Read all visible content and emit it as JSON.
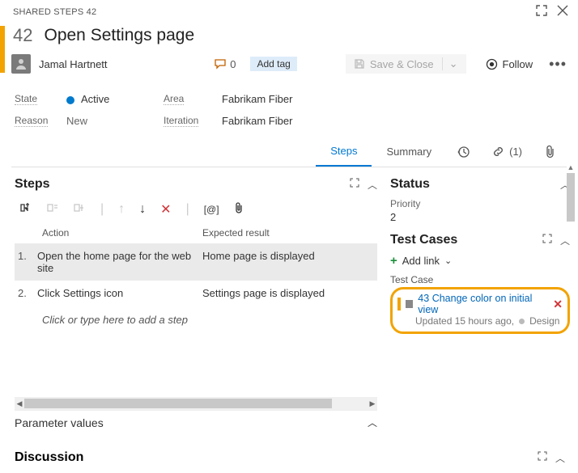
{
  "header": {
    "breadcrumb": "SHARED STEPS 42"
  },
  "workitem": {
    "id": "42",
    "title": "Open Settings page",
    "assignee": "Jamal Hartnett",
    "discussion_count": "0",
    "add_tag": "Add tag",
    "save": "Save & Close",
    "follow": "Follow"
  },
  "fields": {
    "state_label": "State",
    "state_value": "Active",
    "reason_label": "Reason",
    "reason_value": "New",
    "area_label": "Area",
    "area_value": "Fabrikam Fiber",
    "iteration_label": "Iteration",
    "iteration_value": "Fabrikam Fiber"
  },
  "tabs": {
    "steps": "Steps",
    "summary": "Summary",
    "links_count": "(1)"
  },
  "steps_section": {
    "heading": "Steps",
    "col_action": "Action",
    "col_expected": "Expected result",
    "rows": [
      {
        "num": "1.",
        "action": "Open the home page for the web site",
        "expected": "Home page is displayed"
      },
      {
        "num": "2.",
        "action": "Click Settings icon",
        "expected": "Settings page is displayed"
      }
    ],
    "placeholder": "Click or type here to add a step",
    "param_values": "Parameter values"
  },
  "right": {
    "status_heading": "Status",
    "priority_label": "Priority",
    "priority_value": "2",
    "testcases_heading": "Test Cases",
    "add_link": "Add link",
    "tc_label": "Test Case",
    "tc_id": "43",
    "tc_title": "Change color on initial view",
    "tc_updated": "Updated 15 hours ago,",
    "tc_state": "Design"
  },
  "discussion": {
    "heading": "Discussion"
  }
}
